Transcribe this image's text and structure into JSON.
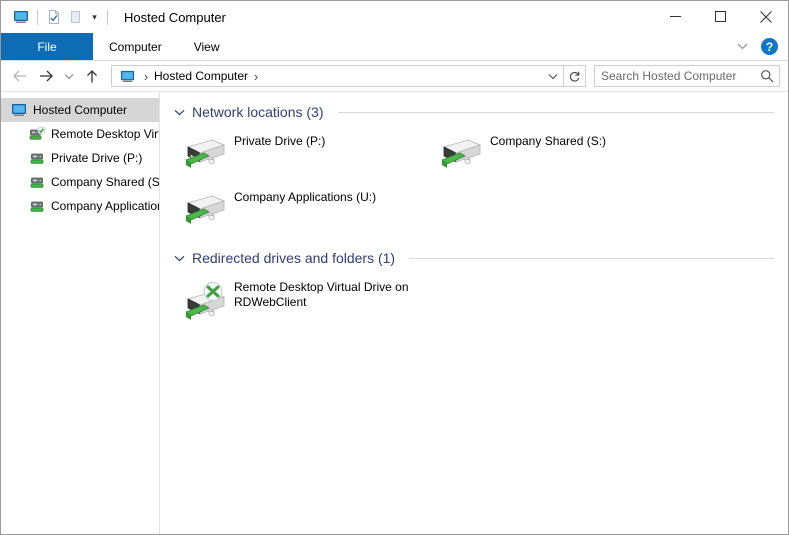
{
  "titlebar": {
    "title": "Hosted Computer",
    "qat_icons": [
      "computer-icon",
      "properties-icon",
      "new-folder-icon"
    ],
    "caret": "▾"
  },
  "window_controls": {
    "minimize": "minimize-button",
    "maximize": "maximize-button",
    "close": "close-button"
  },
  "ribbon": {
    "tabs": [
      {
        "label": "File",
        "active": true
      },
      {
        "label": "Computer",
        "active": false
      },
      {
        "label": "View",
        "active": false
      }
    ],
    "expand_chevron": "⌄",
    "help_label": "?",
    "accent_color": "#0d6cb4"
  },
  "address": {
    "back": "back-button",
    "forward": "forward-button",
    "recent": "recent-locations-button",
    "up": "up-button",
    "breadcrumb": [
      {
        "label": "Hosted Computer"
      }
    ],
    "separator": "›",
    "dropdown": "˅",
    "refresh": "↻"
  },
  "search": {
    "placeholder": "Search Hosted Computer",
    "value": ""
  },
  "sidebar": {
    "items": [
      {
        "label": "Hosted Computer",
        "icon": "computer-icon",
        "level": 0,
        "selected": true
      },
      {
        "label": "Remote Desktop Virtual Drive on RDWebClient",
        "icon": "redirected-drive-icon",
        "level": 1,
        "selected": false
      },
      {
        "label": "Private Drive (P:)",
        "icon": "network-drive-icon",
        "level": 1,
        "selected": false
      },
      {
        "label": "Company Shared (S:)",
        "icon": "network-drive-icon",
        "level": 1,
        "selected": false
      },
      {
        "label": "Company Applications (U:)",
        "icon": "network-drive-icon",
        "level": 1,
        "selected": false
      }
    ]
  },
  "content": {
    "groups": [
      {
        "title": "Network locations (3)",
        "chevron": "˅",
        "items": [
          {
            "label": "Private Drive (P:)",
            "icon": "network-drive-icon"
          },
          {
            "label": "Company Shared (S:)",
            "icon": "network-drive-icon"
          },
          {
            "label": "Company Applications (U:)",
            "icon": "network-drive-icon"
          }
        ]
      },
      {
        "title": "Redirected drives and folders (1)",
        "chevron": "˅",
        "items": [
          {
            "label": "Remote Desktop Virtual Drive on RDWebClient",
            "icon": "redirected-drive-icon"
          }
        ]
      }
    ]
  },
  "colors": {
    "group_heading": "#2e3f73",
    "selection": "#d6d6d6",
    "file_tab": "#0d6cb4",
    "drive_green": "#4ab04a"
  }
}
